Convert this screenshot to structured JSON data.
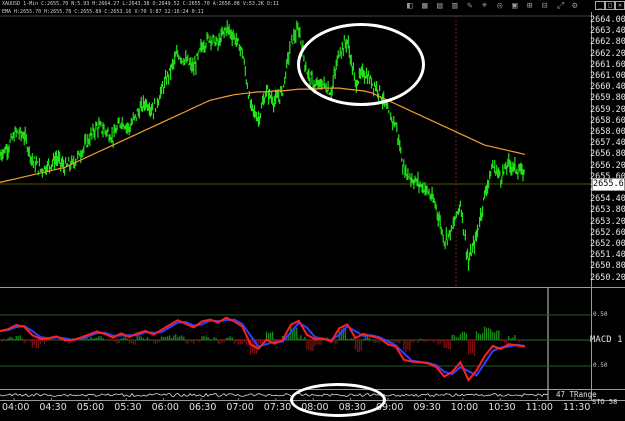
{
  "header": {
    "line1": "XAUUSD 1-Min C:2655.70 N:5.93 H:2664.27 L:2643.38 O:2649.52 C:2655.70 A:2656.08 V:53.2K O:11",
    "line2": "EMA  H:2655.70 H:2655.78 C:2655.89 C:2653.16 V:70 S:87 12:16:24 0:11"
  },
  "top_icons": [
    "◧",
    "▦",
    "▤",
    "▥",
    "✎",
    "⌖",
    "◎",
    "▣",
    "⊞",
    "⊟",
    "⤢",
    "⚙"
  ],
  "window_buttons": [
    "_",
    "□",
    "×"
  ],
  "price_axis": {
    "labels": [
      "2664.00",
      "2663.40",
      "2662.80",
      "2662.20",
      "2661.60",
      "2661.00",
      "2660.40",
      "2659.80",
      "2659.20",
      "2658.60",
      "2658.00",
      "2657.40",
      "2656.80",
      "2656.20",
      "2655.60",
      "2655.00",
      "2654.40",
      "2653.80",
      "2653.20",
      "2652.60",
      "2652.00",
      "2651.40",
      "2650.80",
      "2650.20"
    ],
    "current_price": "2655.67"
  },
  "chart_data": {
    "type": "line",
    "series": [
      {
        "values": [
          2656.8,
          2657.2,
          2658.0,
          2657.8,
          2656.5,
          2656.0,
          2656.2,
          2656.6,
          2656.1,
          2656.3,
          2656.9,
          2657.6,
          2658.3,
          2658.1,
          2657.7,
          2658.6,
          2658.2,
          2659.0,
          2659.6,
          2659.2,
          2660.2,
          2661.2,
          2662.2,
          2661.8,
          2661.4,
          2662.6,
          2663.1,
          2662.7,
          2663.6,
          2663.1,
          2662.3,
          2659.4,
          2658.7,
          2660.2,
          2659.6,
          2660.2,
          2662.8,
          2663.5,
          2661.2,
          2660.4,
          2660.6,
          2660.1,
          2662.3,
          2662.9,
          2660.6,
          2661.2,
          2660.7,
          2660.2,
          2659.0,
          2658.4,
          2656.0,
          2655.5,
          2655.2,
          2654.8,
          2654.0,
          2652.2,
          2652.8,
          2654.2,
          2651.0,
          2652.4,
          2654.6,
          2656.2,
          2655.6,
          2656.3,
          2656.0,
          2655.7
        ]
      },
      {
        "values": [
          2655.3,
          2655.4,
          2655.5,
          2655.6,
          2655.7,
          2655.8,
          2655.9,
          2656.0,
          2656.1,
          2656.3,
          2656.5,
          2656.7,
          2656.9,
          2657.1,
          2657.3,
          2657.5,
          2657.7,
          2657.9,
          2658.1,
          2658.3,
          2658.5,
          2658.7,
          2658.9,
          2659.1,
          2659.3,
          2659.5,
          2659.7,
          2659.8,
          2659.9,
          2660.0,
          2660.05,
          2660.1,
          2660.15,
          2660.15,
          2660.2,
          2660.2,
          2660.25,
          2660.3,
          2660.3,
          2660.3,
          2660.35,
          2660.35,
          2660.35,
          2660.3,
          2660.25,
          2660.2,
          2660.1,
          2659.9,
          2659.7,
          2659.5,
          2659.3,
          2659.1,
          2658.9,
          2658.7,
          2658.5,
          2658.3,
          2658.1,
          2657.9,
          2657.7,
          2657.5,
          2657.3,
          2657.2,
          2657.1,
          2657.0,
          2656.9,
          2656.8
        ]
      }
    ],
    "x_ticks": [
      "04:00",
      "04:30",
      "05:00",
      "05:30",
      "06:00",
      "06:30",
      "07:00",
      "07:30",
      "08:00",
      "08:30",
      "09:00",
      "09:30",
      "10:00",
      "10:30",
      "11:00",
      "11:30"
    ],
    "y_ticks": [
      "2664.00",
      "2663.40",
      "2662.80",
      "2662.20",
      "2661.60",
      "2661.00",
      "2660.40",
      "2659.80",
      "2659.20",
      "2658.60",
      "2658.00",
      "2657.40",
      "2656.80",
      "2656.20",
      "2655.60",
      "2655.00",
      "2654.40",
      "2653.80",
      "2653.20",
      "2652.60",
      "2652.00",
      "2651.40",
      "2650.80",
      "2650.20"
    ],
    "ylim": [
      2650.0,
      2664.8
    ]
  },
  "indicators": {
    "macd_label": "MACD 1",
    "macd_upper": "0.50",
    "macd_lower": "0.50",
    "bottom_label": "47 TRange",
    "bottom_label2": "STO 58"
  },
  "colors": {
    "background": "#000000",
    "candles": "#22e01a",
    "ema": "#f0a030",
    "macd_fast": "#ff2020",
    "macd_slow": "#3040ff",
    "hist_pos": "#1a8a1a",
    "hist_neg": "#7a1010",
    "grid_line": "#2a5a2a",
    "annotation": "#ffffff"
  }
}
